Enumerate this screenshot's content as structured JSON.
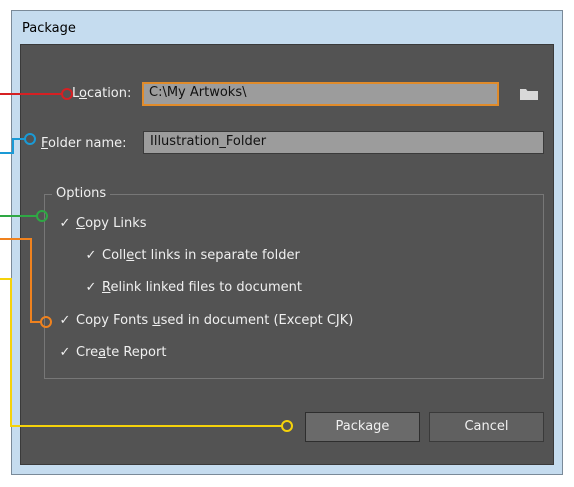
{
  "window": {
    "title": "Package"
  },
  "location": {
    "label_pre": "L",
    "label_u": "o",
    "label_post": "cation:",
    "value": "C:\\My Artwoks\\"
  },
  "folder_name": {
    "label_pre": "",
    "label_u": "F",
    "label_post": "older name:",
    "value": "Illustration_Folder"
  },
  "options": {
    "legend": "Options",
    "copy_links": {
      "pre": "",
      "u": "C",
      "post": "opy Links",
      "checked": true
    },
    "collect_links": {
      "pre": "Coll",
      "u": "e",
      "post": "ct links in separate folder",
      "checked": true
    },
    "relink": {
      "pre": "",
      "u": "R",
      "post": "elink linked files to document",
      "checked": true
    },
    "copy_fonts": {
      "pre": "Copy Fonts ",
      "u": "u",
      "post": "sed in document (Except CJK)",
      "checked": true
    },
    "create_report": {
      "pre": "Cre",
      "u": "a",
      "post": "te Report",
      "checked": true
    }
  },
  "buttons": {
    "package": "Package",
    "cancel": "Cancel"
  },
  "callout_colors": {
    "location": "#d62023",
    "folder_name": "#1a9ad6",
    "copy_links": "#2ea844",
    "copy_fonts": "#f0821e",
    "package": "#f5d20a"
  },
  "check_glyph": "✓"
}
